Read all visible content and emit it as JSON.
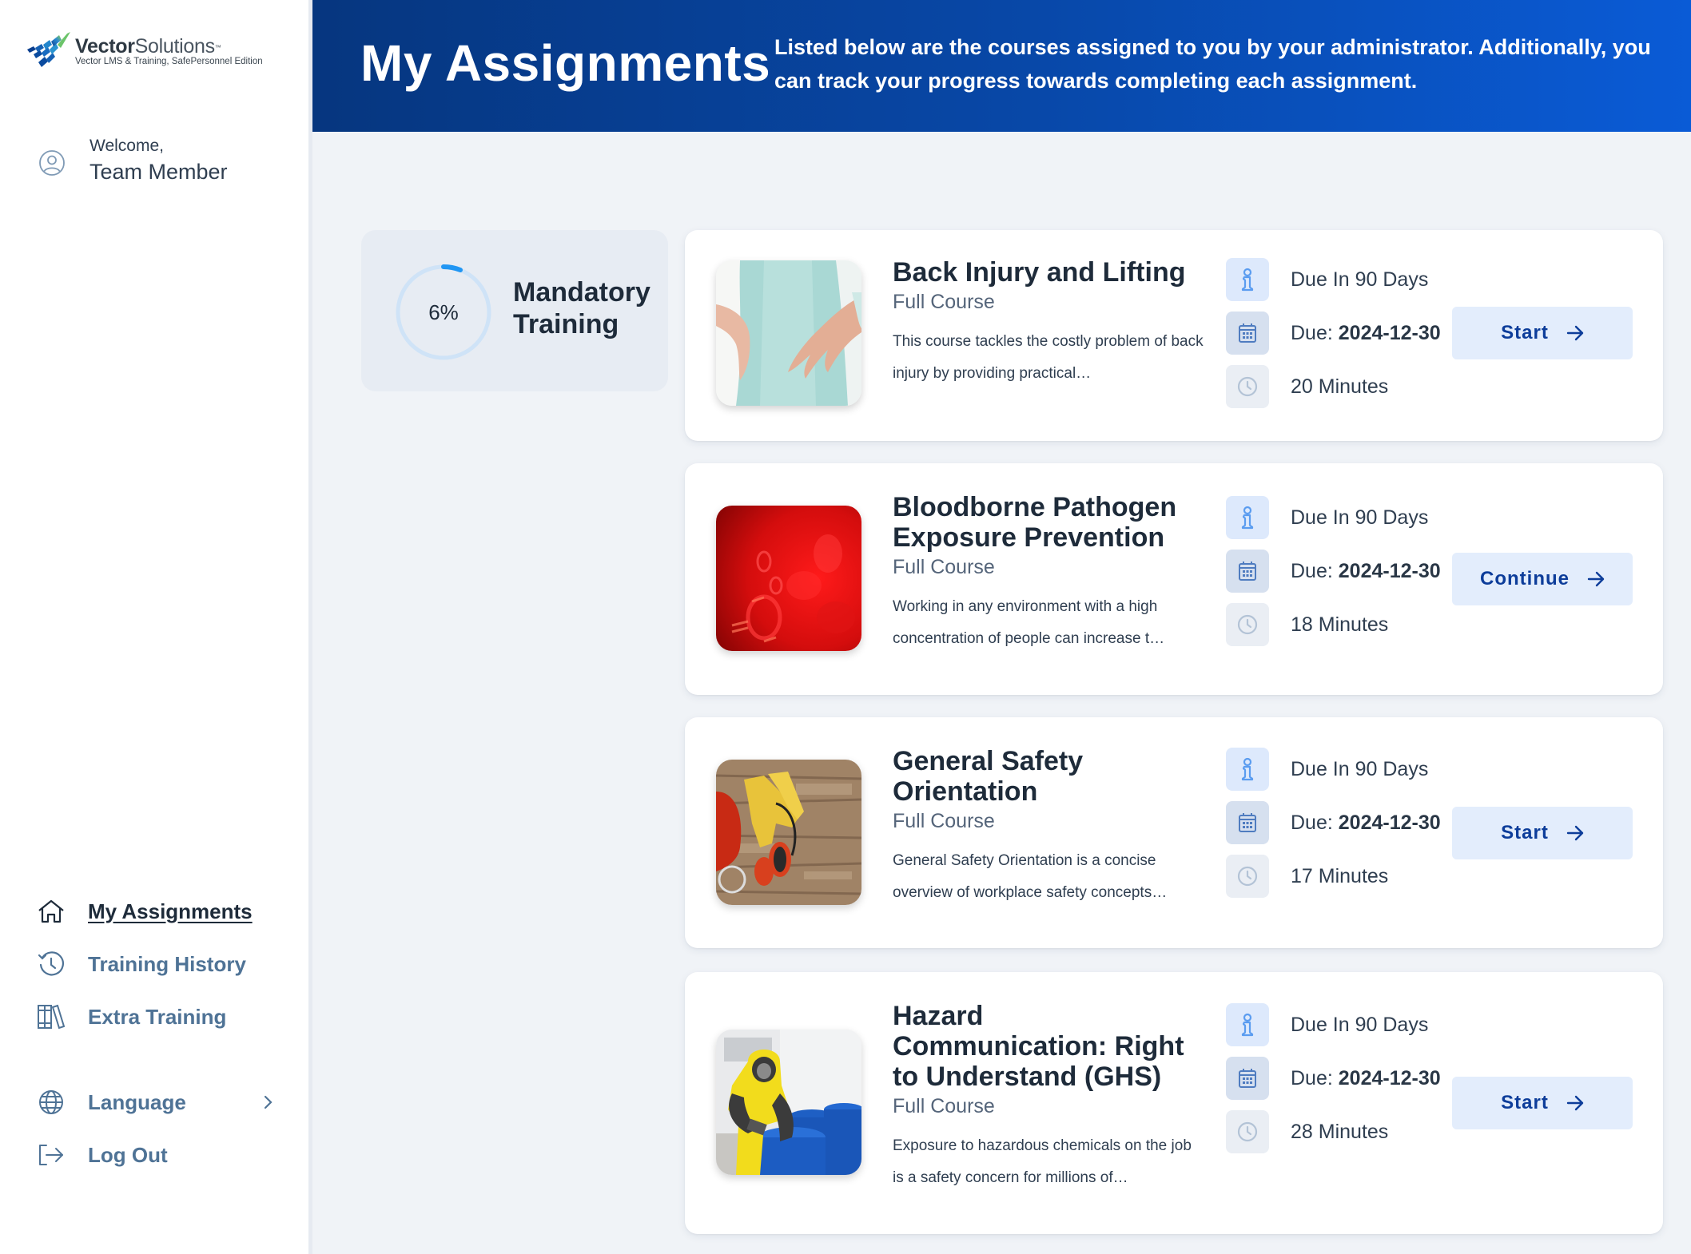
{
  "brand": {
    "name_bold": "Vector",
    "name_light": "Solutions",
    "trademark": "™",
    "subtitle": "Vector LMS & Training, SafePersonnel Edition"
  },
  "user": {
    "welcome_label": "Welcome,",
    "name": "Team Member",
    "icon": "user-circle-icon"
  },
  "nav": {
    "items": [
      {
        "label": "My Assignments",
        "icon": "home-icon",
        "active": true
      },
      {
        "label": "Training History",
        "icon": "history-icon",
        "active": false
      },
      {
        "label": "Extra Training",
        "icon": "library-icon",
        "active": false
      }
    ],
    "secondary": [
      {
        "label": "Language",
        "icon": "globe-icon",
        "has_submenu": true
      },
      {
        "label": "Log Out",
        "icon": "logout-icon",
        "has_submenu": false
      }
    ]
  },
  "header": {
    "title": "My Assignments",
    "description": "Listed below are the courses assigned to you by your administrator. Additionally, you can track your progress towards completing each assignment."
  },
  "progress": {
    "percent_label": "6%",
    "percent_value": 6,
    "label": "Mandatory Training",
    "ring_color": "#2196f3",
    "track_color": "#cfe3f7"
  },
  "courses": [
    {
      "title": "Back Injury and Lifting",
      "type": "Full Course",
      "description": "This course tackles the costly problem of back injury by providing practical…",
      "due_in": "Due In 90 Days",
      "due_label": "Due:",
      "due_date": "2024-12-30",
      "duration": "20 Minutes",
      "action": "Start",
      "image": "back-injury-image"
    },
    {
      "title": "Bloodborne Pathogen Exposure Prevention",
      "type": "Full Course",
      "description": "Working in any environment with a high concentration of people can increase t…",
      "due_in": "Due In 90 Days",
      "due_label": "Due:",
      "due_date": "2024-12-30",
      "duration": "18 Minutes",
      "action": "Continue",
      "image": "blood-cells-image"
    },
    {
      "title": "General Safety Orientation",
      "type": "Full Course",
      "description": "General Safety Orientation is a concise overview of workplace safety concepts…",
      "due_in": "Due In 90 Days",
      "due_label": "Due:",
      "due_date": "2024-12-30",
      "duration": "17 Minutes",
      "action": "Start",
      "image": "safety-gear-image"
    },
    {
      "title": "Hazard Communication: Right to Understand (GHS)",
      "type": "Full Course",
      "description": "Exposure to hazardous chemicals on the job is a safety concern for millions of…",
      "due_in": "Due In 90 Days",
      "due_label": "Due:",
      "due_date": "2024-12-30",
      "duration": "28 Minutes",
      "action": "Start",
      "image": "hazmat-worker-image"
    }
  ],
  "colors": {
    "header_gradient_start": "#06367f",
    "header_gradient_end": "#0a5bd6",
    "button_bg": "#e3edfc",
    "button_text": "#0d3d9a",
    "nav_text": "#4f7396",
    "page_bg": "#f0f3f7"
  }
}
